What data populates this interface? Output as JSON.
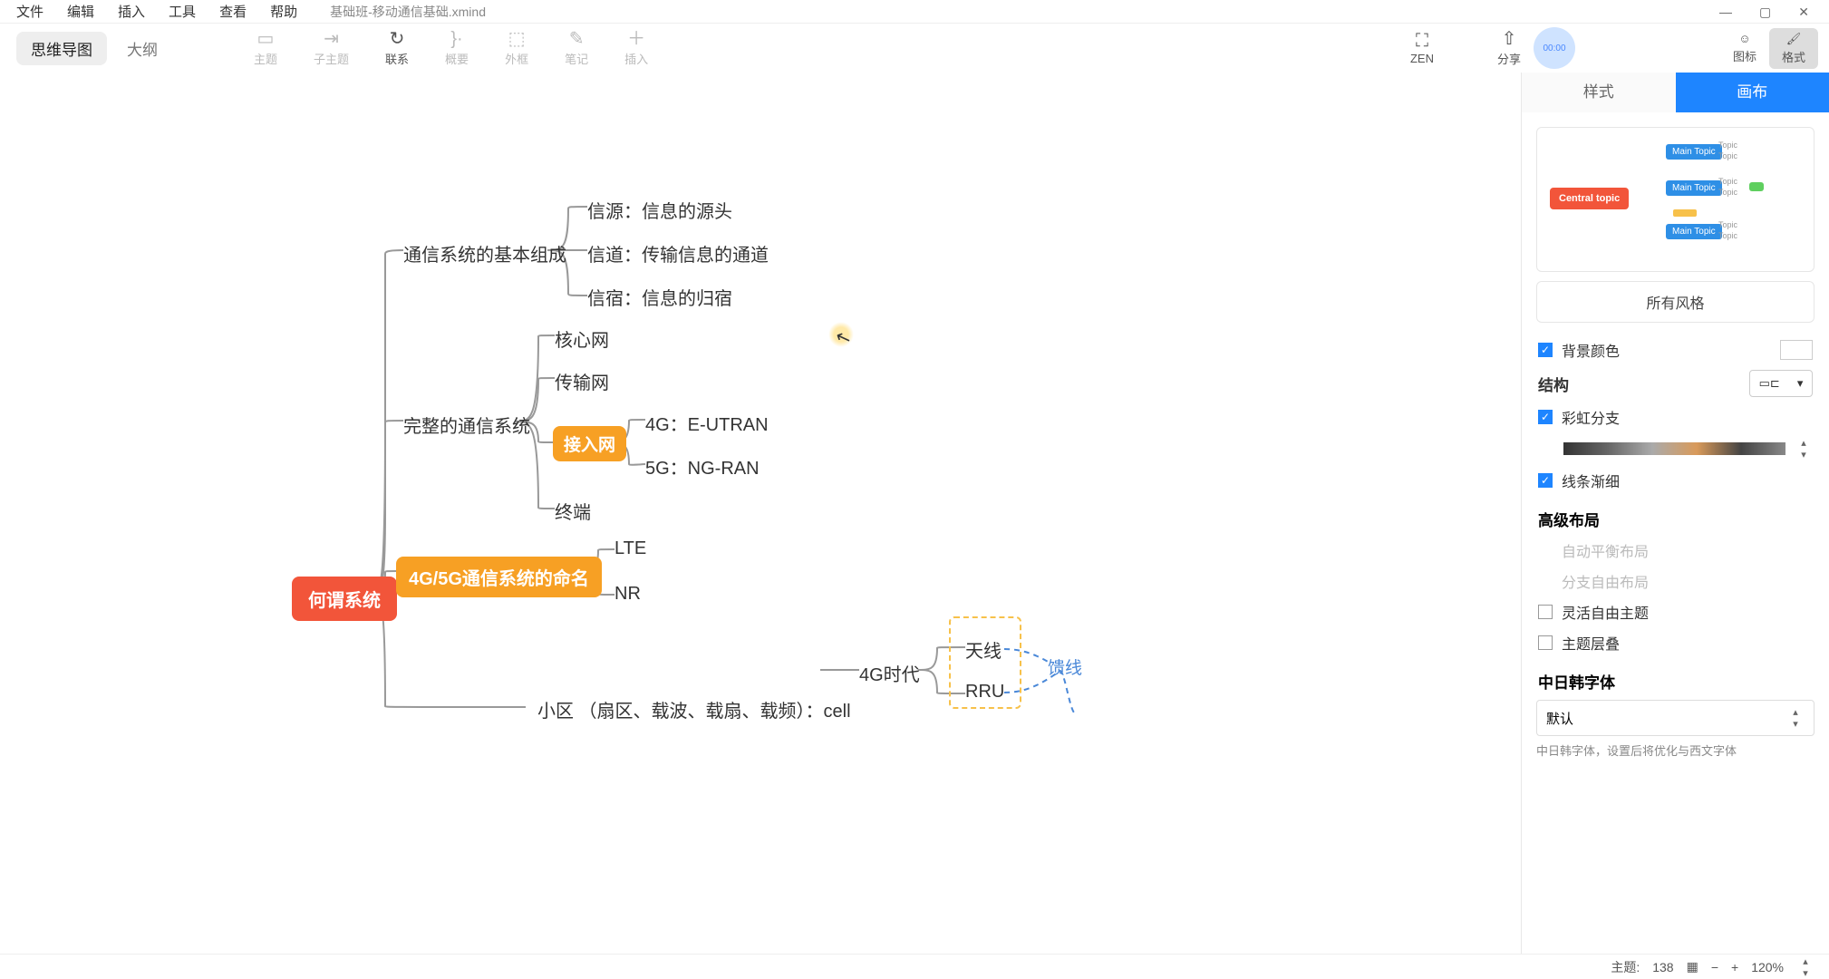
{
  "menu": {
    "file": "文件",
    "edit": "编辑",
    "insert": "插入",
    "tools": "工具",
    "view": "查看",
    "help": "帮助",
    "filename": "基础班-移动通信基础.xmind"
  },
  "viewtabs": {
    "mindmap": "思维导图",
    "outline": "大纲"
  },
  "tools": {
    "topic": "主题",
    "subtopic": "子主题",
    "relation": "联系",
    "summary": "概要",
    "boundary": "外框",
    "note": "笔记",
    "insert": "插入",
    "zen": "ZEN",
    "share": "分享",
    "icons": "图标",
    "format": "格式"
  },
  "timer": "00:00",
  "map": {
    "root": "何谓系统",
    "b1": "通信系统的基本组成",
    "b1c1": "信源：信息的源头",
    "b1c2": "信道：传输信息的通道",
    "b1c3": "信宿：信息的归宿",
    "b2": "完整的通信系统",
    "b2c1": "核心网",
    "b2c2": "传输网",
    "b2c3": "接入网",
    "b2c3a": "4G：E-UTRAN",
    "b2c3b": "5G：NG-RAN",
    "b2c4": "终端",
    "b3": "4G/5G通信系统的命名",
    "b3c1": "LTE",
    "b3c2": "NR",
    "b4tail": "小区   （扇区、载波、载扇、载频）：cell",
    "b5": "4G时代",
    "b5c1": "天线",
    "b5c2": "RRU",
    "feed": "馈线"
  },
  "rpanel": {
    "tab_style": "样式",
    "tab_canvas": "画布",
    "theme_central": "Central topic",
    "theme_main": "Main Topic",
    "theme_topic": "Topic",
    "all_styles": "所有风格",
    "bg": "背景颜色",
    "structure": "结构",
    "rainbow": "彩虹分支",
    "taper": "线条渐细",
    "adv": "高级布局",
    "adv1": "自动平衡布局",
    "adv2": "分支自由布局",
    "adv3": "灵活自由主题",
    "adv4": "主题层叠",
    "cjk": "中日韩字体",
    "font_default": "默认",
    "font_hint": "中日韩字体，设置后将优化与西文字体"
  },
  "status": {
    "topic_label": "主题:",
    "topic_count": "138",
    "zoom": "120%"
  }
}
